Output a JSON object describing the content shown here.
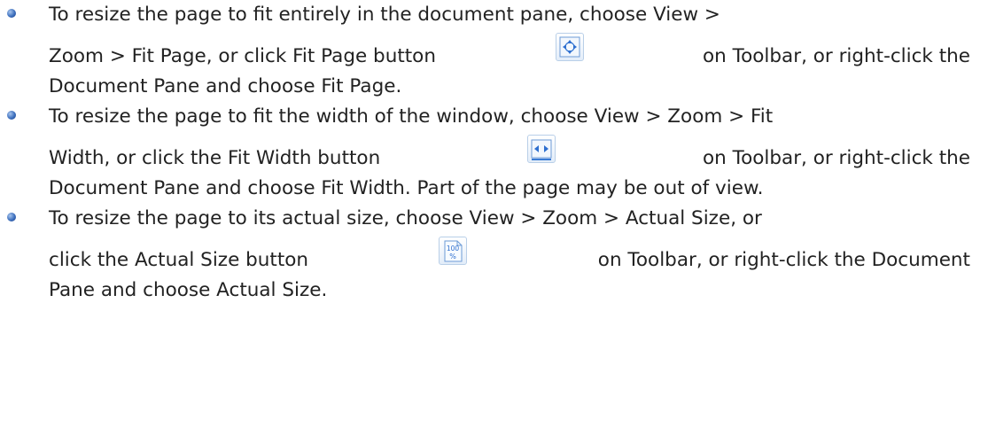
{
  "items": [
    {
      "line1": "To resize the page to fit entirely in the document pane, choose View >",
      "line2a": "Zoom > Fit Page, or click Fit Page button",
      "line2b": "on Toolbar, or right-click the",
      "line3": "Document Pane and choose Fit Page.",
      "icon": "fit-page-icon"
    },
    {
      "line1": "To resize the page to fit the width of the window, choose View > Zoom > Fit",
      "line2a": "Width, or click the Fit Width button",
      "line2b": "on Toolbar, or right-click the",
      "line3": "Document Pane and choose Fit Width. Part of the page may be out of view.",
      "icon": "fit-width-icon"
    },
    {
      "line1": "To resize the page to its actual size, choose View > Zoom > Actual Size, or",
      "line2a": "click the Actual Size button",
      "line2b": "on Toolbar, or right-click the Document",
      "line3": "Pane and choose Actual Size.",
      "icon": "actual-size-icon",
      "icon_text": "100 %"
    }
  ],
  "colors": {
    "text": "#222222",
    "bullet": "#3d6fbd",
    "icon_border": "#b9cfe8"
  }
}
